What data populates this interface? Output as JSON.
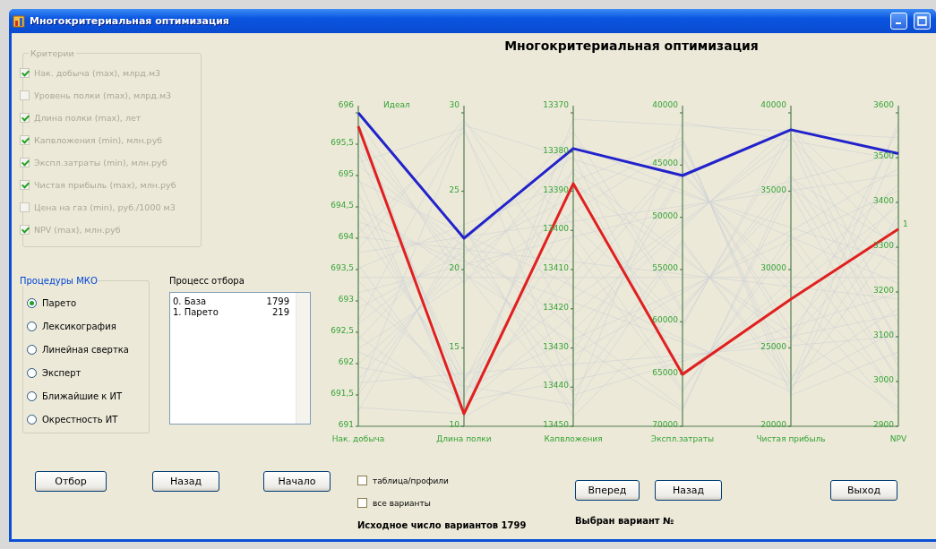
{
  "window": {
    "title": "Многокритериальная оптимизация"
  },
  "criteria": {
    "title": "Критерии",
    "disabled": true,
    "items": [
      {
        "label": "Нак. добыча (max), млрд.м3",
        "checked": true
      },
      {
        "label": "Уровень полки (max), млрд.м3",
        "checked": false
      },
      {
        "label": "Длина полки (max), лет",
        "checked": true
      },
      {
        "label": "Капвложения (min), млн.руб",
        "checked": true
      },
      {
        "label": "Экспл.затраты (min), млн.руб",
        "checked": true
      },
      {
        "label": "Чистая прибыль (max), млн.руб",
        "checked": true
      },
      {
        "label": "Цена на газ (min), руб./1000 м3",
        "checked": false
      },
      {
        "label": "NPV (max), млн.руб",
        "checked": true
      }
    ]
  },
  "procedures": {
    "title": "Процедуры МКО",
    "items": [
      {
        "label": "Парето",
        "selected": true
      },
      {
        "label": "Лексикография",
        "selected": false
      },
      {
        "label": "Линейная свертка",
        "selected": false
      },
      {
        "label": "Эксперт",
        "selected": false
      },
      {
        "label": "Ближайшие к ИТ",
        "selected": false
      },
      {
        "label": "Окрестность ИТ",
        "selected": false
      }
    ]
  },
  "selection_process": {
    "title": "Процесс отбора",
    "rows": [
      {
        "name": "0. База",
        "count": "1799"
      },
      {
        "name": "1. Парето",
        "count": "219"
      }
    ]
  },
  "chart": {
    "title": "Многокритериальная оптимизация",
    "axes": [
      {
        "name": "Нак. добыча",
        "ticks": [
          "696",
          "695,5",
          "695",
          "694,5",
          "694",
          "693,5",
          "693",
          "692,5",
          "692",
          "691,5",
          "691"
        ]
      },
      {
        "name": "Длина полки",
        "ticks": [
          "30",
          "25",
          "20",
          "15",
          "10"
        ]
      },
      {
        "name": "Капвложения",
        "ticks": [
          "13370",
          "13380",
          "13390",
          "13400",
          "13410",
          "13420",
          "13430",
          "13440",
          "13450"
        ]
      },
      {
        "name": "Экспл.затраты",
        "ticks": [
          "40000",
          "45000",
          "50000",
          "55000",
          "60000",
          "65000",
          "70000"
        ]
      },
      {
        "name": "Чистая прибыль",
        "ticks": [
          "40000",
          "35000",
          "30000",
          "25000",
          "20000"
        ]
      },
      {
        "name": "NPV",
        "ticks": [
          "3600",
          "3500",
          "3400",
          "3300",
          "3200",
          "3100",
          "3000",
          "2900"
        ]
      }
    ],
    "series": [
      {
        "label": "Идеал",
        "color": "#2222cc"
      },
      {
        "label": "1",
        "color": "#e02020"
      }
    ]
  },
  "left_buttons": [
    "Отбор",
    "Назад",
    "Начало"
  ],
  "options": [
    {
      "label": "таблица/профили",
      "checked": false
    },
    {
      "label": "все варианты",
      "checked": false
    }
  ],
  "nav_buttons": [
    "Вперед",
    "Назад"
  ],
  "exit_button": "Выход",
  "initial_count_text": "Исходное число вариантов 1799",
  "selected_variant_text": "Выбран вариант №"
}
